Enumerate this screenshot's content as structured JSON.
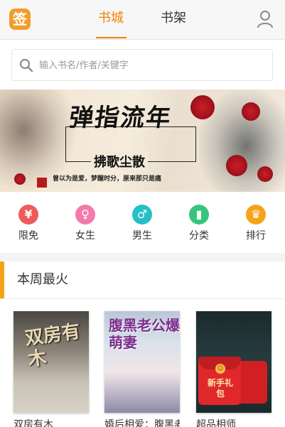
{
  "header": {
    "logo_text": "签",
    "tabs": [
      {
        "label": "书城",
        "active": true
      },
      {
        "label": "书架",
        "active": false
      }
    ],
    "user_icon": "user-icon"
  },
  "search": {
    "placeholder": "输入书名/作者/关键字",
    "icon": "search-icon"
  },
  "banner": {
    "title": "弹指流年",
    "subtitle": "拂歌尘散",
    "tagline": "曾以为是爱，梦醒时分，原来那只是痛"
  },
  "categories": [
    {
      "label": "限免",
      "glyph": "¥",
      "color": "#ef5a5a",
      "icon": "yen-icon"
    },
    {
      "label": "女生",
      "glyph": "♀",
      "color": "#f27bab",
      "icon": "female-icon"
    },
    {
      "label": "男生",
      "glyph": "♂",
      "color": "#26bfc5",
      "icon": "male-icon"
    },
    {
      "label": "分类",
      "glyph": "▮",
      "color": "#34c77b",
      "icon": "book-icon"
    },
    {
      "label": "排行",
      "glyph": "♛",
      "color": "#f5a31a",
      "icon": "trophy-icon"
    }
  ],
  "weekly": {
    "title": "本周最火",
    "accent": "#f5a21b",
    "books": [
      {
        "title": "双房有木",
        "cover_text": "双房有木"
      },
      {
        "title": "婚后相爱：腹黑老公爆萌妻",
        "cover_text": "腹黑老公爆萌妻"
      },
      {
        "title": "超品相师",
        "promo_text": "新手礼包"
      }
    ]
  },
  "colors": {
    "accent": "#f08200"
  }
}
